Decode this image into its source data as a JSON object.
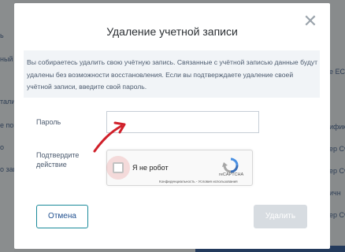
{
  "background": {
    "left_fragments": [
      "ь",
      "ный",
      "тали",
      "е пом",
      "о",
      "о зап"
    ],
    "right_fragments": [
      "е ЕСИ",
      "ифик",
      "ер Сч",
      "ифик",
      "ер Сч",
      "ичн",
      "ер Сч"
    ]
  },
  "dialog": {
    "title": "Удаление учетной записи",
    "close_icon": "close-icon",
    "notice": "Вы собираетесь удалить свою учётную запись. Связанные с учётной записью данные будут удалены без возможности восстановления. Если вы подтверждаете удаление своей учётной записи, введите свой пароль.",
    "password_label": "Пароль",
    "confirm_label": "Подтвердите действие",
    "recaptcha": {
      "checkbox_label": "Я не робот",
      "brand": "reCAPTCHA",
      "links": "Конфиденциальность - Условия использования"
    },
    "cancel_label": "Отмена",
    "delete_label": "Удалить"
  },
  "colors": {
    "accent": "#1a8a9a",
    "arrow": "#d0202a",
    "disabled_button": "#d7dce1"
  }
}
